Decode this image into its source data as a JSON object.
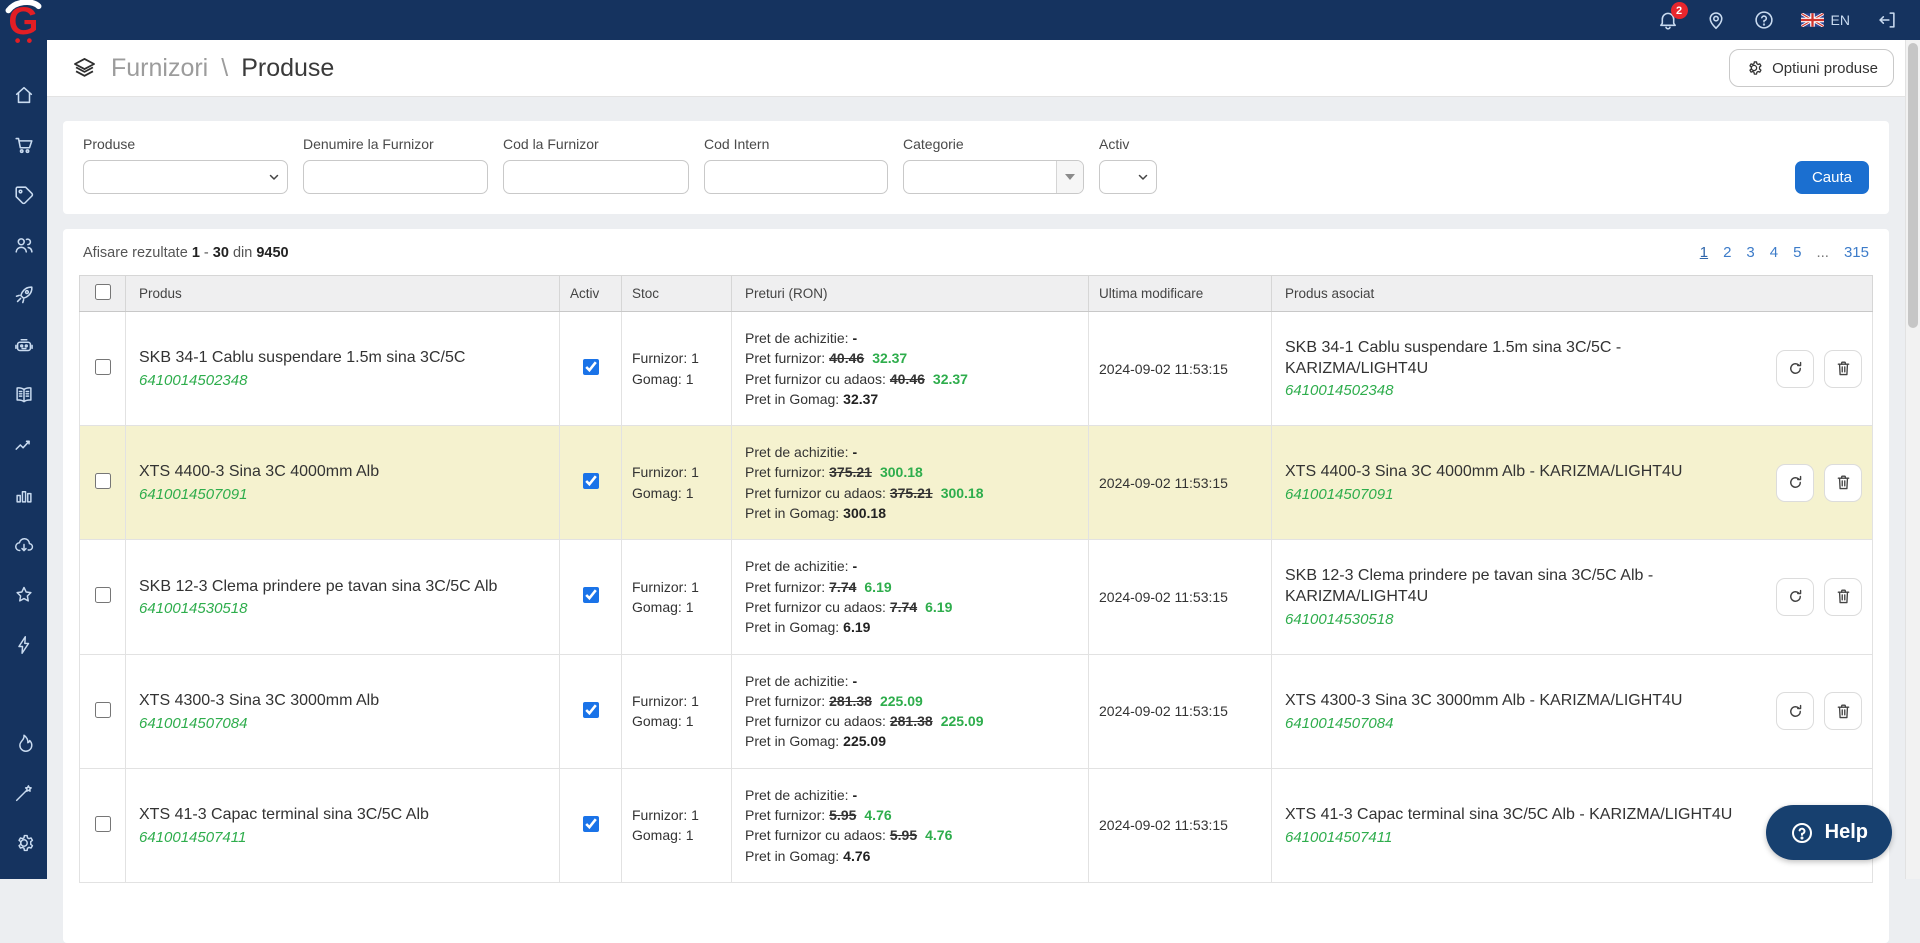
{
  "topbar": {
    "notification_count": "2",
    "language": "EN",
    "icons": [
      "bell",
      "location-pin",
      "help-circle",
      "uk-flag",
      "logout"
    ]
  },
  "sidebar": {
    "icons": [
      "home",
      "cart",
      "tag",
      "users",
      "rocket",
      "robot",
      "book",
      "chart-line",
      "chart-bar",
      "cloud-download",
      "star",
      "bolt",
      "flame",
      "wand",
      "gear"
    ]
  },
  "page_header": {
    "breadcrumb": {
      "parent": "Furnizori",
      "separator": "\\",
      "current": "Produse"
    },
    "options_button_label": "Optiuni produse"
  },
  "filters": {
    "produse": {
      "label": "Produse",
      "value": ""
    },
    "denumire_furnizor": {
      "label": "Denumire la Furnizor",
      "value": ""
    },
    "cod_furnizor": {
      "label": "Cod la Furnizor",
      "value": ""
    },
    "cod_intern": {
      "label": "Cod Intern",
      "value": ""
    },
    "categorie": {
      "label": "Categorie",
      "value": ""
    },
    "activ": {
      "label": "Activ",
      "value": ""
    },
    "search_button_label": "Cauta"
  },
  "results": {
    "summary": {
      "prefix": "Afisare rezultate",
      "from": "1",
      "separator": "-",
      "to": "30",
      "of_word": "din",
      "total": "9450"
    },
    "pagination": [
      {
        "label": "1",
        "current": true
      },
      {
        "label": "2"
      },
      {
        "label": "3"
      },
      {
        "label": "4"
      },
      {
        "label": "5"
      },
      {
        "label": "...",
        "ellipsis": true
      },
      {
        "label": "315"
      }
    ]
  },
  "table": {
    "headers": {
      "produs": "Produs",
      "activ": "Activ",
      "stoc": "Stoc",
      "preturi": "Preturi (RON)",
      "ultima_modificare": "Ultima modificare",
      "produs_asociat": "Produs asociat"
    },
    "price_labels": {
      "achizitie": "Pret de achizitie:",
      "furnizor": "Pret furnizor:",
      "adaos": "Pret furnizor cu adaos:",
      "gomag": "Pret in Gomag:"
    },
    "rows": [
      {
        "produs_name": "SKB 34-1 Cablu suspendare 1.5m sina 3C/5C",
        "produs_code": "6410014502348",
        "activ": true,
        "stoc_furnizor": "Furnizor: 1",
        "stoc_gomag": "Gomag: 1",
        "pret_achizitie": "-",
        "pret_furnizor_old": "40.46",
        "pret_furnizor_new": "32.37",
        "pret_adaos_old": "40.46",
        "pret_adaos_new": "32.37",
        "pret_gomag": "32.37",
        "ultima_modificare": "2024-09-02 11:53:15",
        "asociat_name": "SKB 34-1 Cablu suspendare 1.5m sina 3C/5C - KARIZMA/LIGHT4U",
        "asociat_code": "6410014502348",
        "highlighted": false
      },
      {
        "produs_name": "XTS 4400-3 Sina 3C 4000mm Alb",
        "produs_code": "6410014507091",
        "activ": true,
        "stoc_furnizor": "Furnizor: 1",
        "stoc_gomag": "Gomag: 1",
        "pret_achizitie": "-",
        "pret_furnizor_old": "375.21",
        "pret_furnizor_new": "300.18",
        "pret_adaos_old": "375.21",
        "pret_adaos_new": "300.18",
        "pret_gomag": "300.18",
        "ultima_modificare": "2024-09-02 11:53:15",
        "asociat_name": "XTS 4400-3 Sina 3C 4000mm Alb - KARIZMA/LIGHT4U",
        "asociat_code": "6410014507091",
        "highlighted": true
      },
      {
        "produs_name": "SKB 12-3 Clema prindere pe tavan sina 3C/5C Alb",
        "produs_code": "6410014530518",
        "activ": true,
        "stoc_furnizor": "Furnizor: 1",
        "stoc_gomag": "Gomag: 1",
        "pret_achizitie": "-",
        "pret_furnizor_old": "7.74",
        "pret_furnizor_new": "6.19",
        "pret_adaos_old": "7.74",
        "pret_adaos_new": "6.19",
        "pret_gomag": "6.19",
        "ultima_modificare": "2024-09-02 11:53:15",
        "asociat_name": "SKB 12-3 Clema prindere pe tavan sina 3C/5C Alb - KARIZMA/LIGHT4U",
        "asociat_code": "6410014530518",
        "highlighted": false
      },
      {
        "produs_name": "XTS 4300-3 Sina 3C 3000mm Alb",
        "produs_code": "6410014507084",
        "activ": true,
        "stoc_furnizor": "Furnizor: 1",
        "stoc_gomag": "Gomag: 1",
        "pret_achizitie": "-",
        "pret_furnizor_old": "281.38",
        "pret_furnizor_new": "225.09",
        "pret_adaos_old": "281.38",
        "pret_adaos_new": "225.09",
        "pret_gomag": "225.09",
        "ultima_modificare": "2024-09-02 11:53:15",
        "asociat_name": "XTS 4300-3 Sina 3C 3000mm Alb - KARIZMA/LIGHT4U",
        "asociat_code": "6410014507084",
        "highlighted": false
      },
      {
        "produs_name": "XTS 41-3 Capac terminal sina 3C/5C Alb",
        "produs_code": "6410014507411",
        "activ": true,
        "stoc_furnizor": "Furnizor: 1",
        "stoc_gomag": "Gomag: 1",
        "pret_achizitie": "-",
        "pret_furnizor_old": "5.95",
        "pret_furnizor_new": "4.76",
        "pret_adaos_old": "5.95",
        "pret_adaos_new": "4.76",
        "pret_gomag": "4.76",
        "ultima_modificare": "2024-09-02 11:53:15",
        "asociat_name": "XTS 41-3 Capac terminal sina 3C/5C Alb - KARIZMA/LIGHT4U",
        "asociat_code": "6410014507411",
        "highlighted": false
      }
    ]
  },
  "help": {
    "label": "Help"
  },
  "colors": {
    "navy": "#15335F",
    "accent_blue": "#1B6FD0",
    "green": "#2EAD4C",
    "red_badge": "#E8262D",
    "highlight_row": "#F5F2CF"
  }
}
